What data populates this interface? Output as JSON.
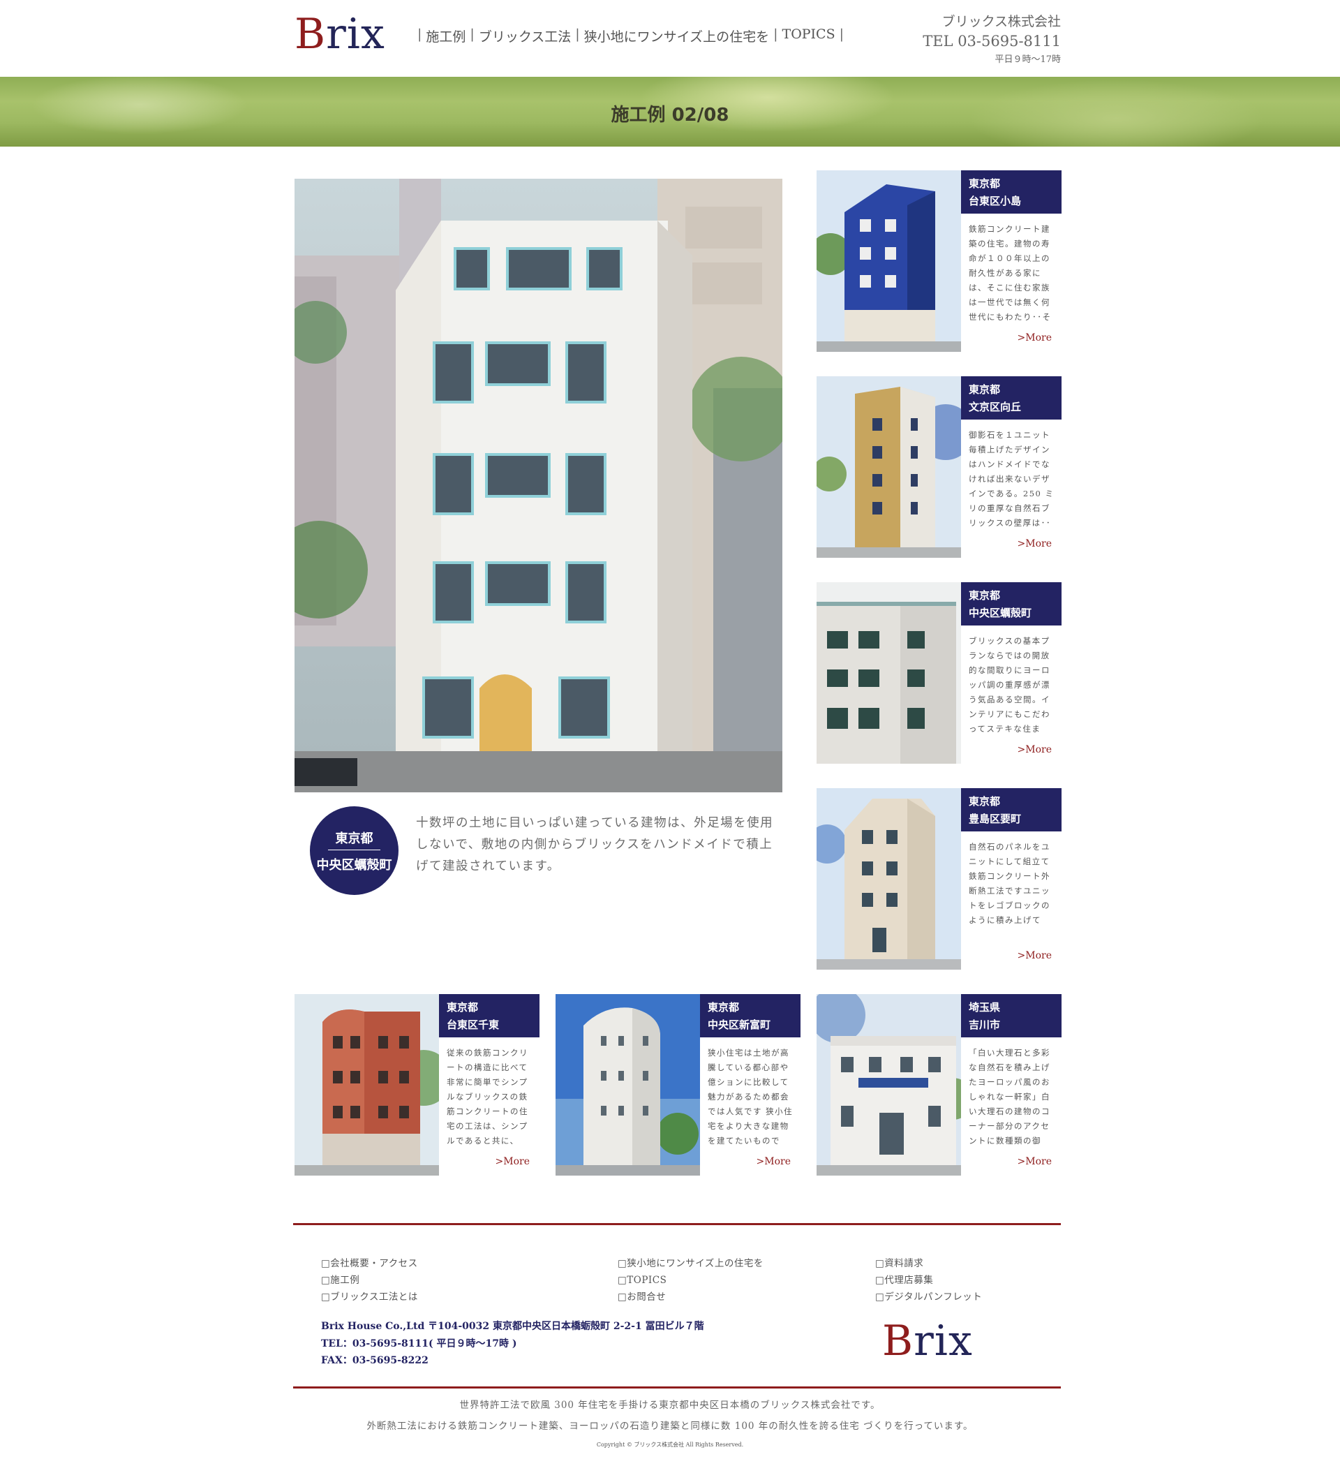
{
  "header": {
    "logo_b": "B",
    "logo_rest": "rix",
    "nav": [
      "施工例",
      "ブリックス工法",
      "狭小地にワンサイズ上の住宅を",
      "TOPICS"
    ],
    "company": "ブリックス株式会社",
    "tel": "TEL 03-5695-8111",
    "hours": "平日９時〜17時"
  },
  "banner": {
    "title": "施工例 02/08"
  },
  "feature": {
    "pref": "東京都",
    "area": "中央区蠣殻町",
    "description": "十数坪の土地に目いっぱい建っている建物は、外足場を使用しないで、敷地の内側からブリックスをハンドメイドで積上げて建設されています。"
  },
  "cards": [
    {
      "pref": "東京都",
      "area": "台東区小島",
      "text": "鉄筋コンクリート建築の住宅。建物の寿命が１００年以上の耐久性がある家には、そこに住む家族は一世代では無く何世代にもわたり･･その家",
      "more": ">More"
    },
    {
      "pref": "東京都",
      "area": "文京区向丘",
      "text": "御影石を１ユニット毎積上げたデザインはハンドメイドでなければ出来ないデザインである。250 ミリの重厚な自然石ブリックスの壁厚は･･",
      "more": ">More"
    },
    {
      "pref": "東京都",
      "area": "中央区蠣殻町",
      "text": "ブリックスの基本プランならではの開放的な間取りにヨーロッパ調の重厚感が漂う気品ある空間。インテリアにもこだわってステキな住ま",
      "more": ">More"
    },
    {
      "pref": "東京都",
      "area": "豊島区要町",
      "text": "自然石のパネルをユニットにして組立て鉄筋コンクリート外断熱工法ですユニットをレゴブロックのように積み上げて",
      "more": ">More"
    },
    {
      "pref": "東京都",
      "area": "台東区千東",
      "text": "従来の鉄筋コンクリートの構造に比べて 非常に簡単でシンプルなブリックスの鉄筋コンクリートの住宅の工法は、シンプルであると共に、",
      "more": ">More"
    },
    {
      "pref": "東京都",
      "area": "中央区新富町",
      "text": "狭小住宅は土地が高騰している都心部や億ションに比較して魅力があるため都会では人気です 狭小住宅をより大きな建物を建てたいもので",
      "more": ">More"
    },
    {
      "pref": "埼玉県",
      "area": "吉川市",
      "text": "「白い大理石と多彩な自然石を積み上げたヨーロッパ風のおしゃれな一軒家」白い大理石の建物のコーナー部分のアクセントに数種類の御",
      "more": ">More"
    }
  ],
  "footer": {
    "links_col1": [
      "□会社概要・アクセス",
      "□施工例",
      "□ブリックス工法とは"
    ],
    "links_col2": [
      "□狭小地にワンサイズ上の住宅を",
      "□TOPICS",
      "□お問合せ"
    ],
    "links_col3": [
      "□資料請求",
      "□代理店募集",
      "□デジタルパンフレット"
    ],
    "address": "Brix House Co.,Ltd 〒104-0032 東京都中央区日本橋蛎殻町 2-2-1 冨田ビル７階",
    "tel": "TEL：03-5695-8111( 平日９時〜17時 )",
    "fax": "FAX：03-5695-8222",
    "tagline1": "世界特許工法で欧風 300 年住宅を手掛ける東京都中央区日本橋のブリックス株式会社です。",
    "tagline2": "外断熱工法における鉄筋コンクリート建築、ヨーロッパの石造り建築と同様に数 100 年の耐久性を誇る住宅 づくりを行っています。",
    "copyright": "Copyright © ブリックス株式会社 All Rights Reserved."
  },
  "colors": {
    "navy": "#232363",
    "accent_red": "#8e1d1d",
    "banner_green": "#9db961"
  }
}
